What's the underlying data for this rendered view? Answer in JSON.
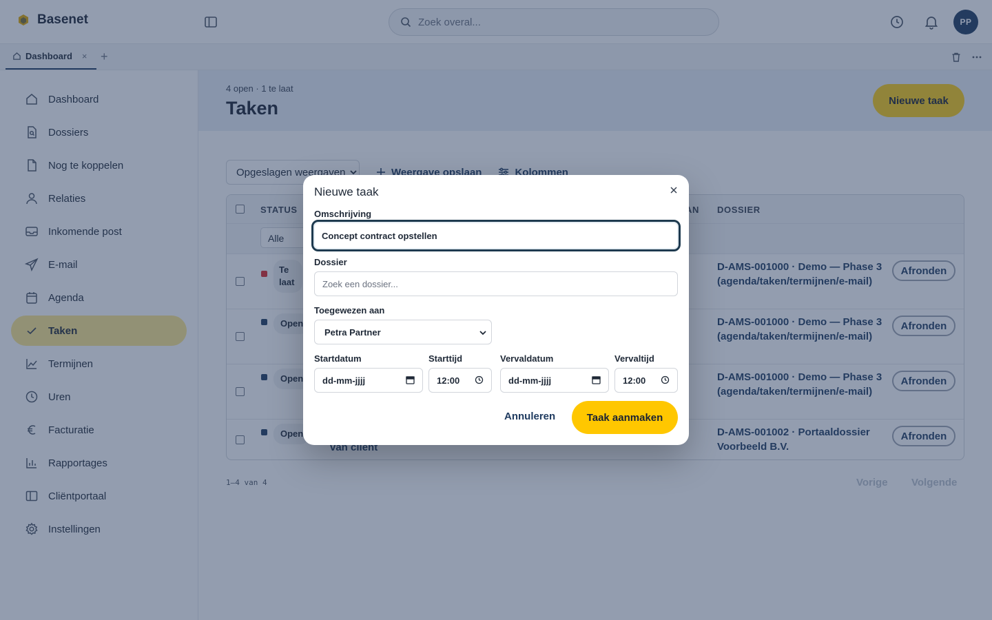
{
  "app": {
    "name": "Basenet",
    "user_initials": "PP"
  },
  "search": {
    "placeholder": "Zoek overal..."
  },
  "tabs": [
    {
      "label": "Dashboard",
      "close": "×"
    }
  ],
  "tab_add": "+",
  "sidebar": {
    "items": [
      {
        "label": "Dashboard",
        "icon": "home-icon"
      },
      {
        "label": "Dossiers",
        "icon": "file-search-icon"
      },
      {
        "label": "Nog te koppelen",
        "icon": "file-icon"
      },
      {
        "label": "Relaties",
        "icon": "user-icon"
      },
      {
        "label": "Inkomende post",
        "icon": "inbox-icon"
      },
      {
        "label": "E-mail",
        "icon": "send-icon"
      },
      {
        "label": "Agenda",
        "icon": "calendar-icon"
      },
      {
        "label": "Taken",
        "icon": "check-icon",
        "active": true
      },
      {
        "label": "Termijnen",
        "icon": "chart-line-icon"
      },
      {
        "label": "Uren",
        "icon": "clock-icon"
      },
      {
        "label": "Facturatie",
        "icon": "euro-icon"
      },
      {
        "label": "Rapportages",
        "icon": "bar-chart-icon"
      },
      {
        "label": "Cliëntportaal",
        "icon": "panel-icon"
      },
      {
        "label": "Instellingen",
        "icon": "gear-icon"
      }
    ]
  },
  "page": {
    "meta": "4 open · 1 te laat",
    "title": "Taken",
    "new_task_label": "Nieuwe taak"
  },
  "toolbar": {
    "saved_views": "Opgeslagen weergaven",
    "save_view": "Weergave opslaan",
    "columns": "Kolommen"
  },
  "table": {
    "headers": {
      "status": "STATUS",
      "assigned_partial": "AN",
      "dossier": "DOSSIER"
    },
    "status_filter": "Alle",
    "rows": [
      {
        "status": "Te laat",
        "status_color": "#dc2626",
        "description": "",
        "dossier": "D-AMS-001000 · Demo — Phase 3 (agenda/taken/termijnen/e-mail)",
        "action": "Afronden"
      },
      {
        "status": "Open",
        "status_color": "#1e3a5f",
        "description": "",
        "dossier": "D-AMS-001000 · Demo — Phase 3 (agenda/taken/termijnen/e-mail)",
        "action": "Afronden"
      },
      {
        "status": "Open",
        "status_color": "#1e3a5f",
        "description": "",
        "dossier": "D-AMS-001000 · Demo — Phase 3 (agenda/taken/termijnen/e-mail)",
        "action": "Afronden"
      },
      {
        "status": "Open",
        "status_color": "#1e3a5f",
        "description": "van cliënt",
        "dossier": "D-AMS-001002 · Portaaldossier Voorbeeld B.V.",
        "action": "Afronden"
      }
    ]
  },
  "pagination": {
    "info": "1–4 van 4",
    "prev": "Vorige",
    "next": "Volgende"
  },
  "modal": {
    "title": "Nieuwe taak",
    "description_label": "Omschrijving",
    "description_value": "Concept contract opstellen",
    "dossier_label": "Dossier",
    "dossier_placeholder": "Zoek een dossier...",
    "assignee_label": "Toegewezen aan",
    "assignee_value": "Petra Partner",
    "start_date_label": "Startdatum",
    "start_date_value": "dd-mm-jjjj",
    "start_time_label": "Starttijd",
    "start_time_value": "12:00",
    "due_date_label": "Vervaldatum",
    "due_date_value": "dd-mm-jjjj",
    "due_time_label": "Vervaltijd",
    "due_time_value": "12:00",
    "cancel_label": "Annuleren",
    "submit_label": "Taak aanmaken"
  },
  "colors": {
    "accent": "#facc15",
    "primary": "#1e3a5f",
    "active_nav": "#fde68a",
    "overdue": "#dc2626"
  }
}
